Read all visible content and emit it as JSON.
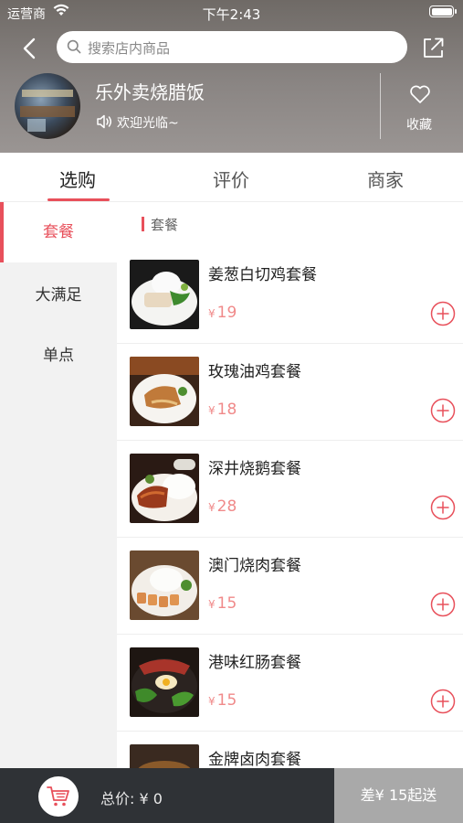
{
  "status": {
    "carrier": "运营商",
    "time": "下午2:43"
  },
  "search": {
    "placeholder": "搜索店内商品"
  },
  "shop": {
    "name": "乐外卖烧腊饭",
    "welcome": "欢迎光临~",
    "favorite": "收藏"
  },
  "tabs": [
    "选购",
    "评价",
    "商家"
  ],
  "categories": [
    "套餐",
    "大满足",
    "单点"
  ],
  "section_title": "套餐",
  "currency": "¥",
  "items": [
    {
      "name": "姜葱白切鸡套餐",
      "price": "19"
    },
    {
      "name": "玫瑰油鸡套餐",
      "price": "18"
    },
    {
      "name": "深井烧鹅套餐",
      "price": "28"
    },
    {
      "name": "澳门烧肉套餐",
      "price": "15"
    },
    {
      "name": "港味红肠套餐",
      "price": "15"
    },
    {
      "name": "金牌卤肉套餐",
      "price": ""
    }
  ],
  "cart": {
    "total": "总价: ¥ 0",
    "checkout": "差¥ 15起送"
  },
  "colors": {
    "accent": "#e8505b",
    "price": "#f08a8a",
    "bottom_bar": "#2f3236"
  }
}
